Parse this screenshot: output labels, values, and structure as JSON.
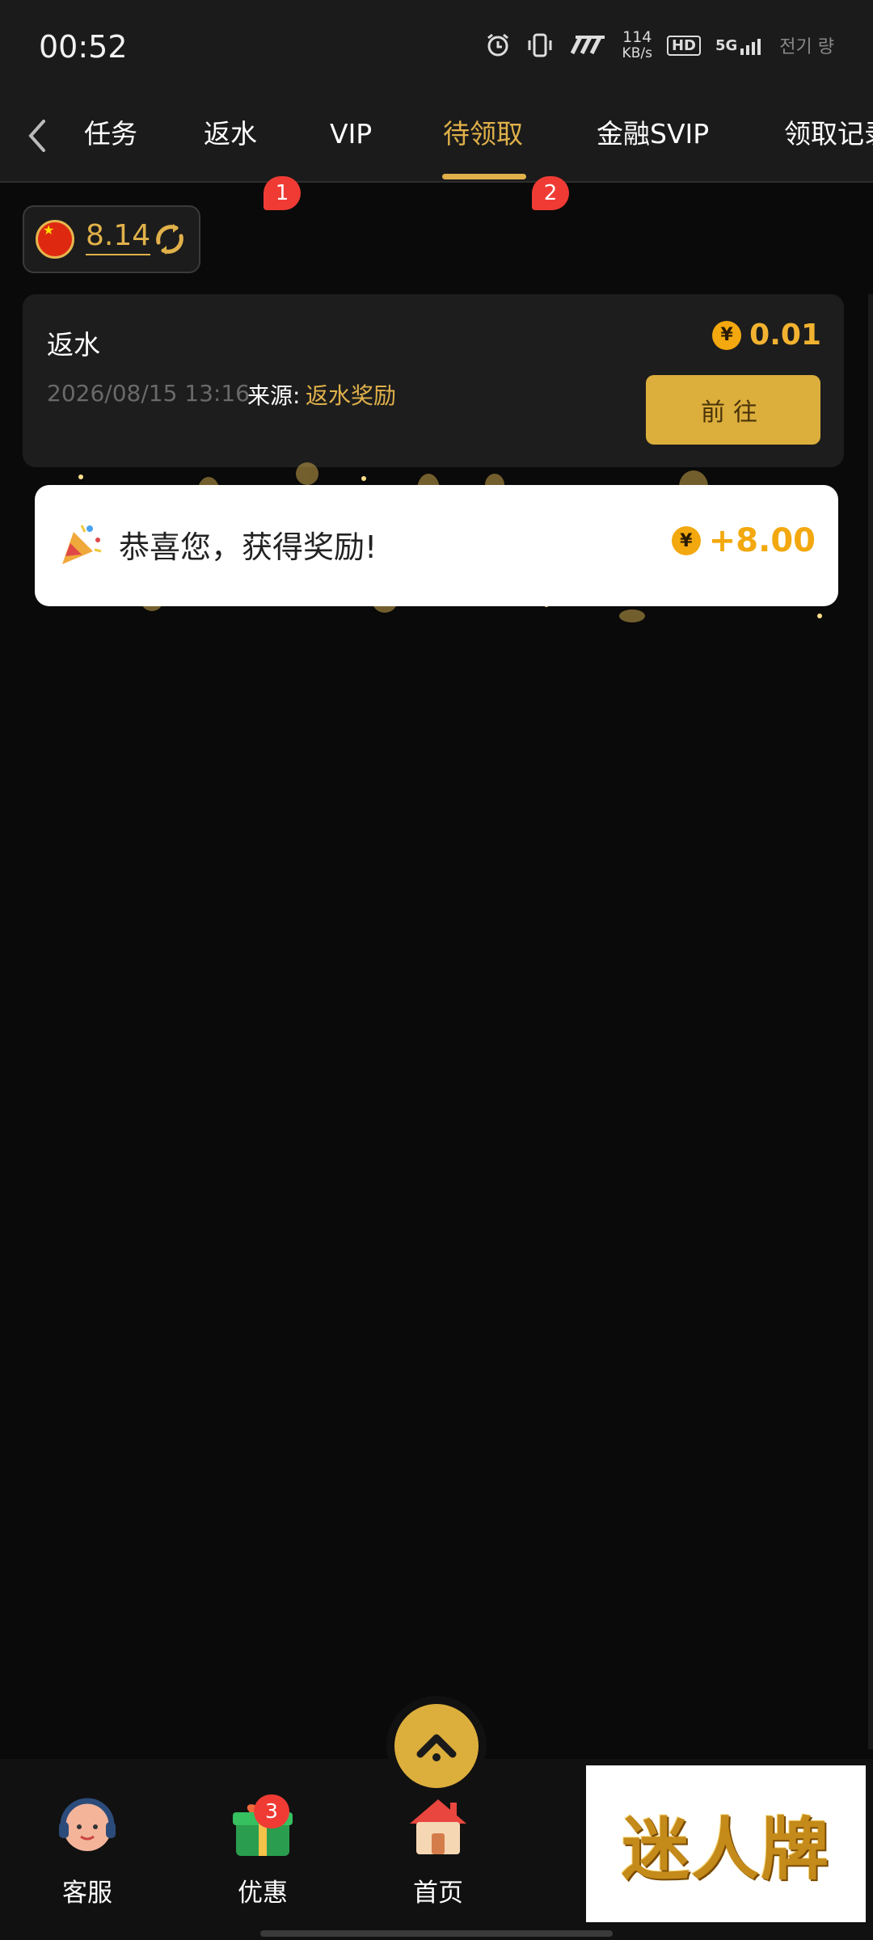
{
  "status_bar": {
    "time": "00:52",
    "net_speed_value": "114",
    "net_speed_unit": "KB/s",
    "hd": "HD",
    "network": "5G",
    "carrier": "전기 량"
  },
  "tabs": [
    {
      "label": "任务",
      "badge": null
    },
    {
      "label": "返水",
      "badge": "1"
    },
    {
      "label": "VIP",
      "badge": null
    },
    {
      "label": "待领取",
      "badge": "2",
      "active": true
    },
    {
      "label": "金融SVIP",
      "badge": null
    },
    {
      "label": "领取记录",
      "badge": null
    }
  ],
  "balance": {
    "currency_flag": "CN",
    "value": "8.14"
  },
  "reward_card": {
    "title": "返水",
    "amount": "0.01",
    "coin_symbol": "¥",
    "date": "2026/08/15 13:16",
    "source_label": "来源:",
    "source_value": "返水奖励",
    "action_label": "前往"
  },
  "toast": {
    "message": "恭喜您，获得奖励!",
    "amount": "+8.00",
    "coin_symbol": "¥"
  },
  "bottom_nav": [
    {
      "label": "客服",
      "icon": "customer-service-icon"
    },
    {
      "label": "优惠",
      "icon": "gift-icon",
      "badge": "3"
    },
    {
      "label": "首页",
      "icon": "home-icon"
    }
  ],
  "ad_banner": {
    "text": "迷人牌"
  },
  "colors": {
    "accent_gold": "#e0b14a",
    "badge_red": "#f03b35",
    "coin_orange": "#f2a80e",
    "background": "#0a0a0a"
  }
}
